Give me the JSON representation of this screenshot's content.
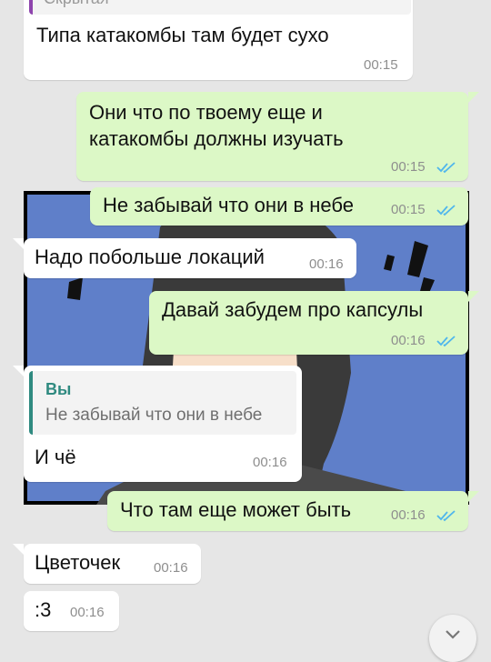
{
  "messages": [
    {
      "quoted_label": "Скрытая",
      "text": "Типа катакомбы там будет сухо",
      "time": "00:15"
    },
    {
      "text_line1": "Они что по твоему еще и",
      "text_line2": "катакомбы должны изучать",
      "time": "00:15"
    },
    {
      "text": "Не забывай что они в небе",
      "time": "00:15"
    },
    {
      "text": "Надо побольше локаций",
      "time": "00:16"
    },
    {
      "text": "Давай забудем про капсулы",
      "time": "00:16"
    },
    {
      "reply_author": "Вы",
      "reply_text": "Не забывай что они в небе",
      "text": "И чё",
      "time": "00:16"
    },
    {
      "text": "Что там еще может быть",
      "time": "00:16"
    },
    {
      "text": "Цветочек",
      "time": "00:16"
    },
    {
      "text": ":3",
      "time": "00:16"
    }
  ],
  "colors": {
    "chat_background": "#e6e6e6",
    "incoming_bubble": "#ffffff",
    "outgoing_bubble": "#dcf8c6",
    "read_ticks": "#4fb6ec",
    "reply_accent": "#2f8a80",
    "illustration_bg": "#5f7fc9"
  },
  "icons": {
    "read_receipt": "double-check-icon",
    "scroll_down": "chevron-down-icon"
  }
}
